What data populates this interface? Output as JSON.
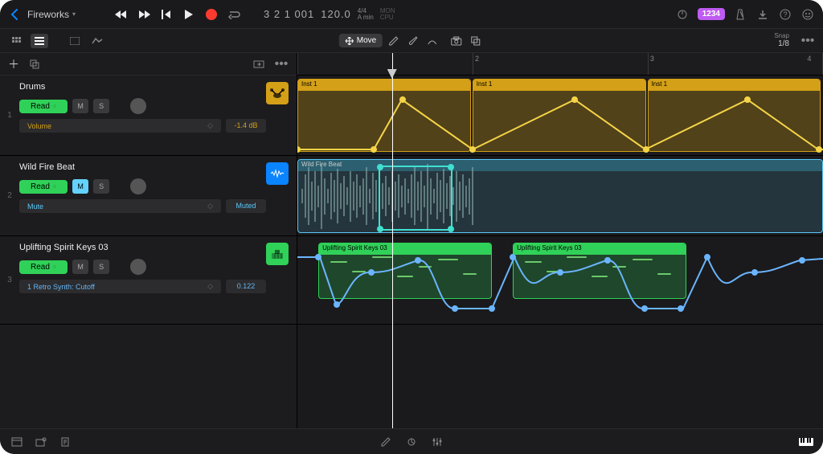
{
  "project": {
    "name": "Fireworks"
  },
  "transport": {
    "position": "3 2 1 001",
    "tempo": "120.0",
    "sig_top": "4/4",
    "sig_bottom": "A min",
    "mon": "MON",
    "cpu": "CPU"
  },
  "topbar": {
    "count_badge": "1234"
  },
  "secbar": {
    "move_label": "Move",
    "snap_label": "Snap",
    "snap_value": "1/8"
  },
  "ruler": {
    "t2": "2",
    "t3": "3",
    "t4": "4"
  },
  "tracks": [
    {
      "num": "1",
      "name": "Drums",
      "read": "Read",
      "m": "M",
      "s": "S",
      "param": "Volume",
      "value": "-1.4 dB",
      "regions": {
        "r1": "Inst 1",
        "r2": "Inst 1",
        "r3": "Inst 1"
      }
    },
    {
      "num": "2",
      "name": "Wild Fire Beat",
      "read": "Read",
      "m": "M",
      "s": "S",
      "param": "Mute",
      "value": "Muted",
      "regions": {
        "r1": "Wild Fire Beat"
      }
    },
    {
      "num": "3",
      "name": "Uplifting Spirit Keys 03",
      "read": "Read",
      "m": "M",
      "s": "S",
      "param": "1 Retro Synth: Cutoff",
      "value": "0.122",
      "regions": {
        "r1": "Uplifting Spirit Keys 03",
        "r2": "Uplifting Spirit Keys 03"
      }
    }
  ]
}
